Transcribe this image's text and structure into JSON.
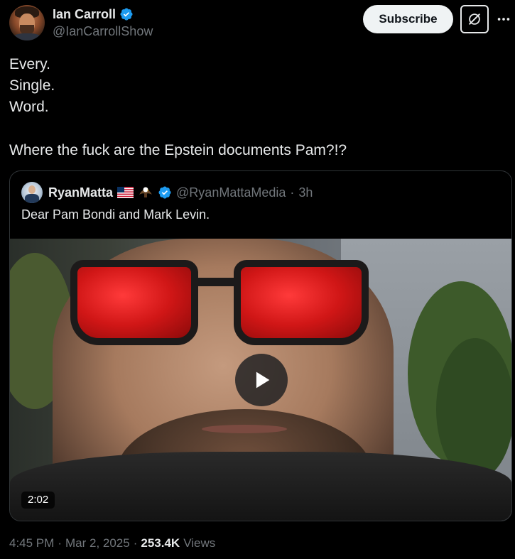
{
  "author": {
    "display_name": "Ian Carroll",
    "handle": "@IanCarrollShow",
    "verified": true
  },
  "actions": {
    "subscribe_label": "Subscribe",
    "grok_icon": "grok-icon",
    "more_icon": "more-icon"
  },
  "tweet": {
    "lines": [
      "Every.",
      "Single.",
      "Word.",
      "",
      "Where the fuck are the Epstein documents Pam?!?"
    ]
  },
  "quoted_tweet": {
    "display_name": "RyanMatta",
    "emoji": [
      "us-flag",
      "eagle"
    ],
    "verified": true,
    "handle": "@RyanMattaMedia",
    "separator": "·",
    "time_ago": "3h",
    "text": "Dear Pam Bondi and Mark Levin.",
    "video": {
      "duration": "2:02",
      "play_icon": "play-icon"
    }
  },
  "meta": {
    "time": "4:45 PM",
    "dot1": "·",
    "date": "Mar 2, 2025",
    "dot2": "·",
    "views_count": "253.4K",
    "views_label": "Views"
  },
  "colors": {
    "background": "#000000",
    "text": "#e7e9ea",
    "muted": "#71767b",
    "verified_blue": "#1d9bf0",
    "border": "#2f3336"
  }
}
